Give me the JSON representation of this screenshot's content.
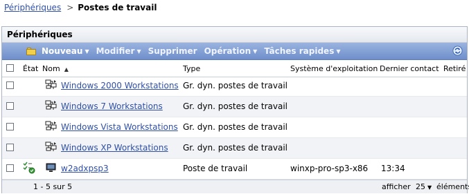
{
  "breadcrumb": {
    "parent": "Périphériques",
    "separator": ">",
    "current": "Postes de travail"
  },
  "panel": {
    "title": "Périphériques"
  },
  "toolbar": {
    "new_label": "Nouveau",
    "modify_label": "Modifier",
    "delete_label": "Supprimer",
    "operation_label": "Opération",
    "quick_tasks_label": "Tâches rapides"
  },
  "table": {
    "headers": {
      "status": "État",
      "name": "Nom",
      "type": "Type",
      "os": "Système d'exploitation",
      "last_contact": "Dernier contact",
      "retired": "Retiré"
    },
    "rows": [
      {
        "name": "Windows 2000 Workstations",
        "type": "Gr. dyn. postes de travail",
        "os": "",
        "last_contact": "",
        "retired": "",
        "icon": "dynamic-group-icon"
      },
      {
        "name": "Windows 7 Workstations",
        "type": "Gr. dyn. postes de travail",
        "os": "",
        "last_contact": "",
        "retired": "",
        "icon": "dynamic-group-icon"
      },
      {
        "name": "Windows Vista Workstations",
        "type": "Gr. dyn. postes de travail",
        "os": "",
        "last_contact": "",
        "retired": "",
        "icon": "dynamic-group-icon"
      },
      {
        "name": "Windows XP Workstations",
        "type": "Gr. dyn. postes de travail",
        "os": "",
        "last_contact": "",
        "retired": "",
        "icon": "dynamic-group-icon"
      },
      {
        "name": "w2adxpsp3",
        "type": "Poste de travail",
        "os": "winxp-pro-sp3-x86",
        "last_contact": "13:34",
        "retired": "",
        "icon": "workstation-icon"
      }
    ]
  },
  "footer": {
    "range": "1 - 5 sur 5",
    "show_label": "afficher",
    "page_size": "25",
    "items_label": "éléments"
  },
  "colors": {
    "toolbar": "#7f9bd3",
    "link": "#2f4fa8",
    "row_alt": "#f1f3f6"
  }
}
